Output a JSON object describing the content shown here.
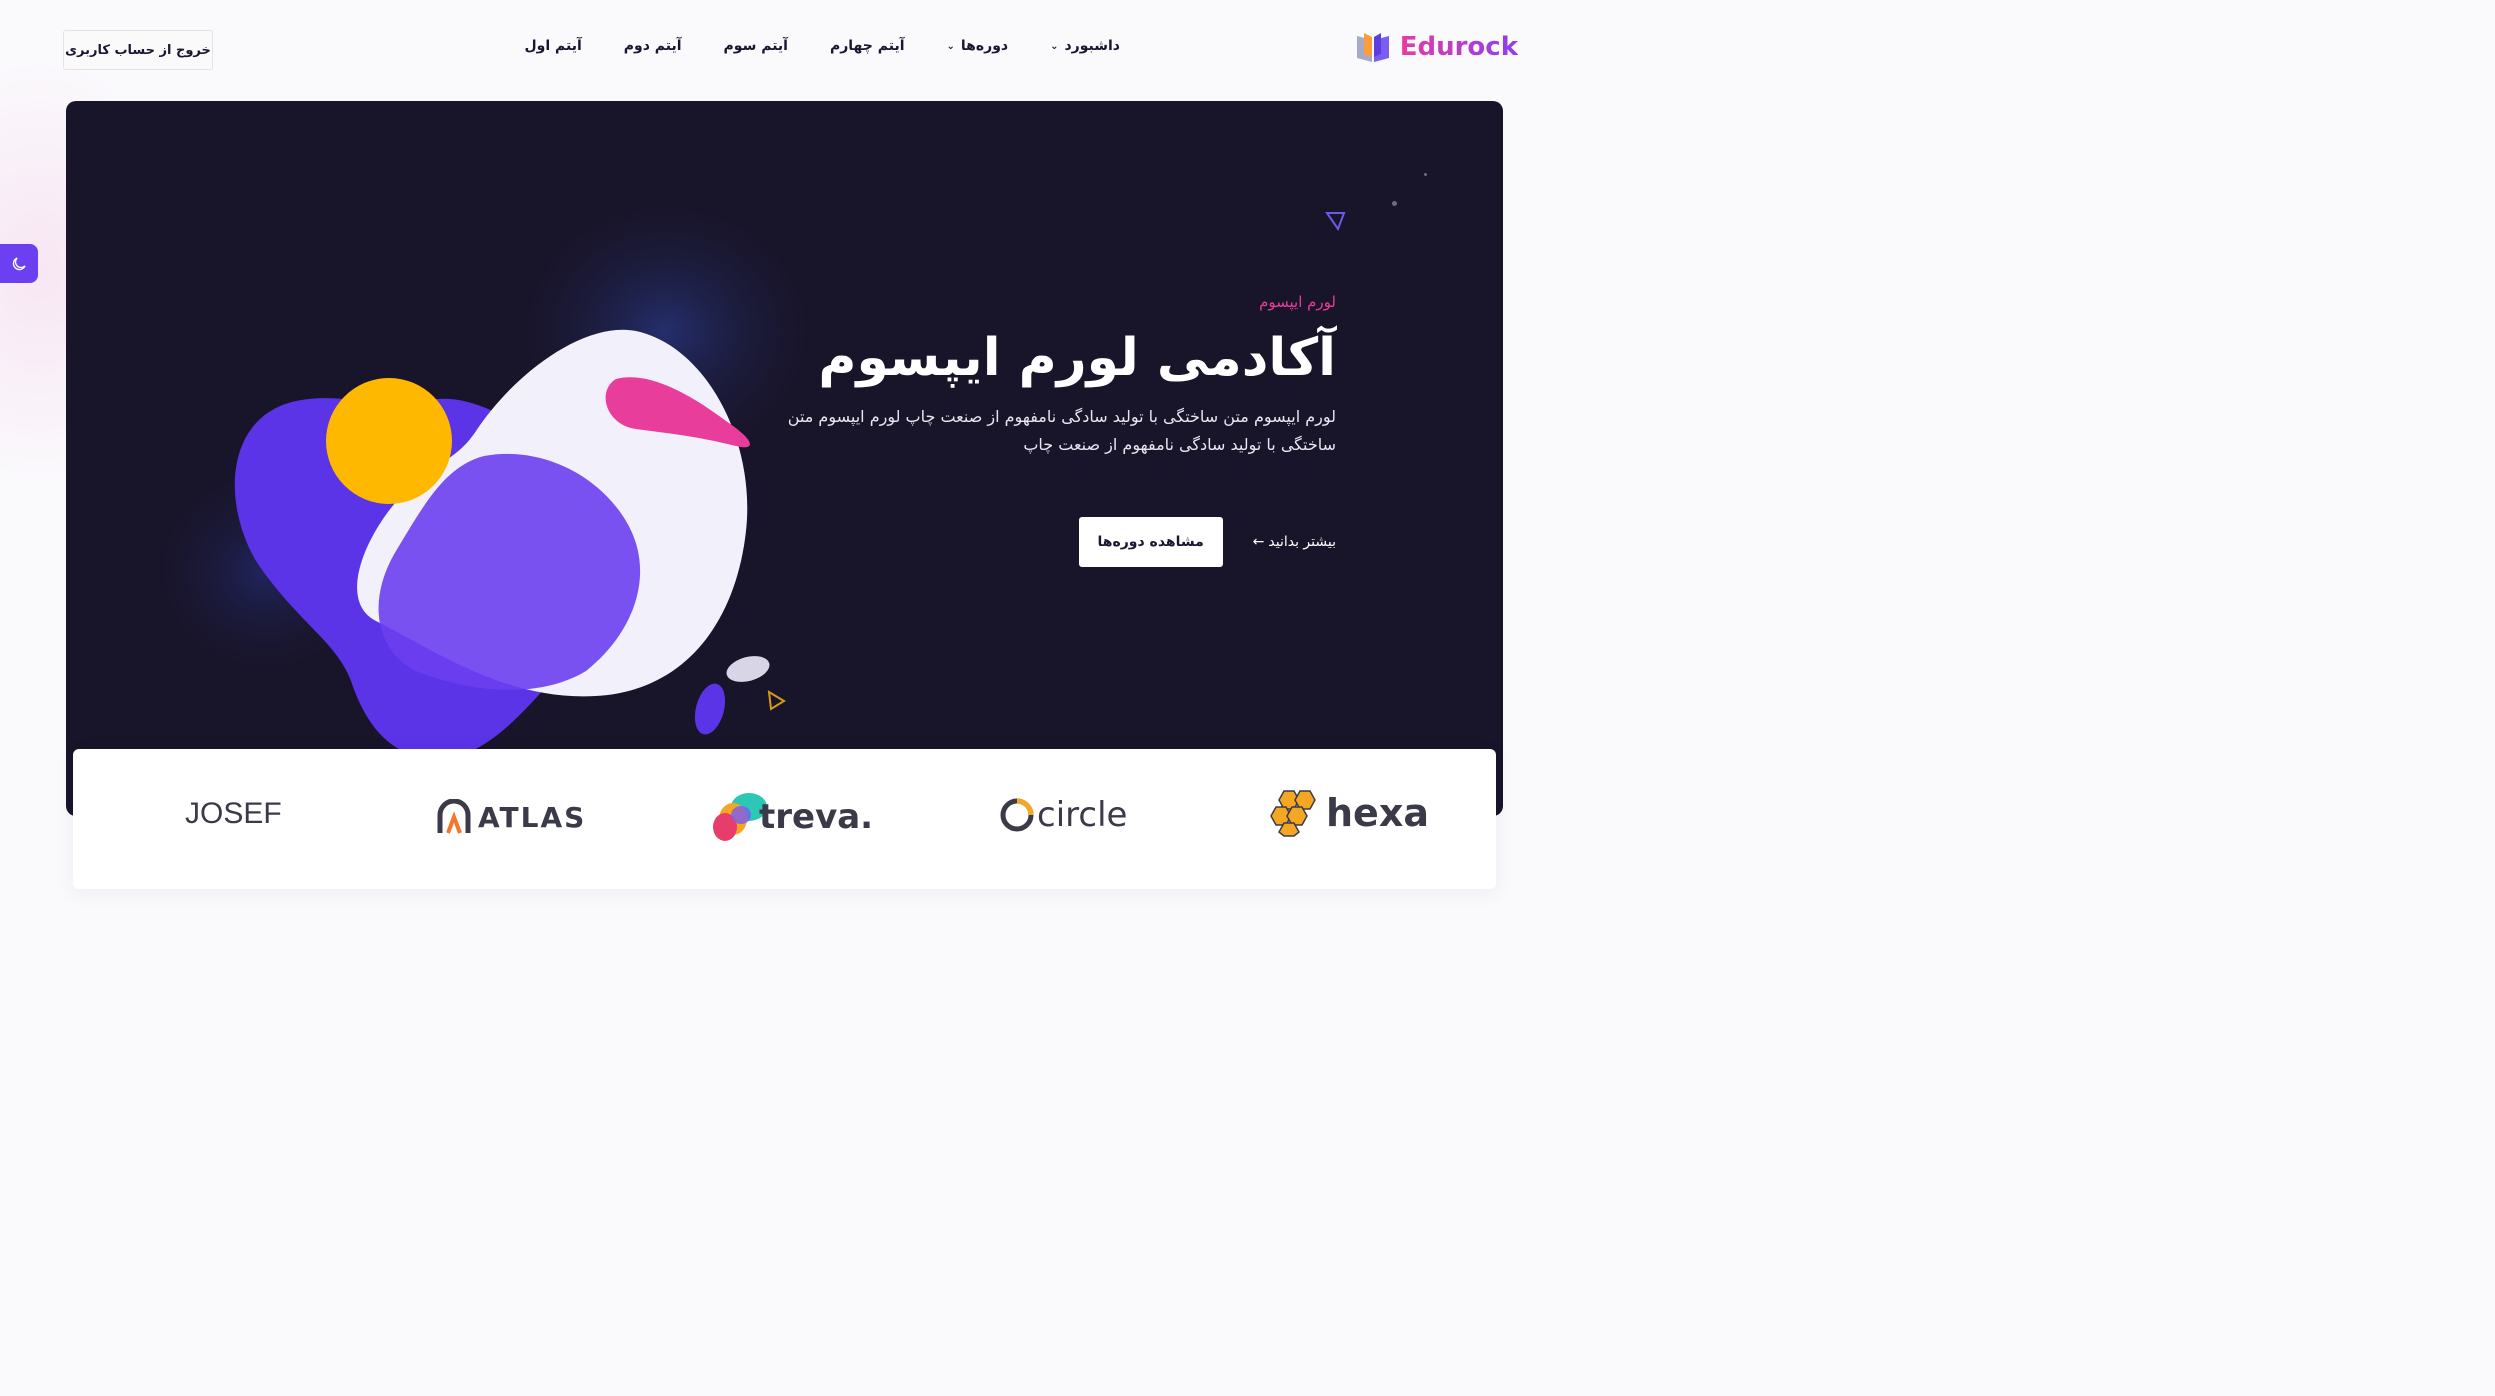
{
  "header": {
    "logo_text": "Edurock",
    "nav": [
      {
        "label": "آیتم اول",
        "has_dropdown": false
      },
      {
        "label": "آیتم دوم",
        "has_dropdown": false
      },
      {
        "label": "آیتم سوم",
        "has_dropdown": false
      },
      {
        "label": "آیتم چهارم",
        "has_dropdown": false
      },
      {
        "label": "دوره‌ها",
        "has_dropdown": true
      },
      {
        "label": "داشبورد",
        "has_dropdown": true
      }
    ],
    "logout_label": "خروج از حساب کاربری"
  },
  "dark_mode_toggle": {
    "icon": "moon-icon"
  },
  "hero": {
    "eyebrow": "لورم ایپسوم",
    "headline": "آکادمی لورم ایپسوم",
    "description": "لورم ایپسوم متن ساختگی با تولید سادگی نامفهوم از صنعت چاپ لورم ایپسوم متن ساختگی با تولید سادگی نامفهوم از صنعت چاپ",
    "primary_button": "مشاهده دوره‌ها",
    "secondary_link": "بیشتر بدانید",
    "secondary_arrow": "←"
  },
  "brands": [
    {
      "name": "hexa",
      "icon": "hexagon-cluster-icon"
    },
    {
      "name": "circle",
      "icon": "circle-ring-icon"
    },
    {
      "name": "treva.",
      "icon": "blob-cluster-icon"
    },
    {
      "name": "ATLAS",
      "icon": "atlas-arch-icon"
    },
    {
      "name": "JOSEF",
      "icon": ""
    }
  ],
  "colors": {
    "accent": "#6c3ff0",
    "pink": "#e83d9a",
    "yellow": "#ffb800",
    "hero_bg": "#181429"
  }
}
